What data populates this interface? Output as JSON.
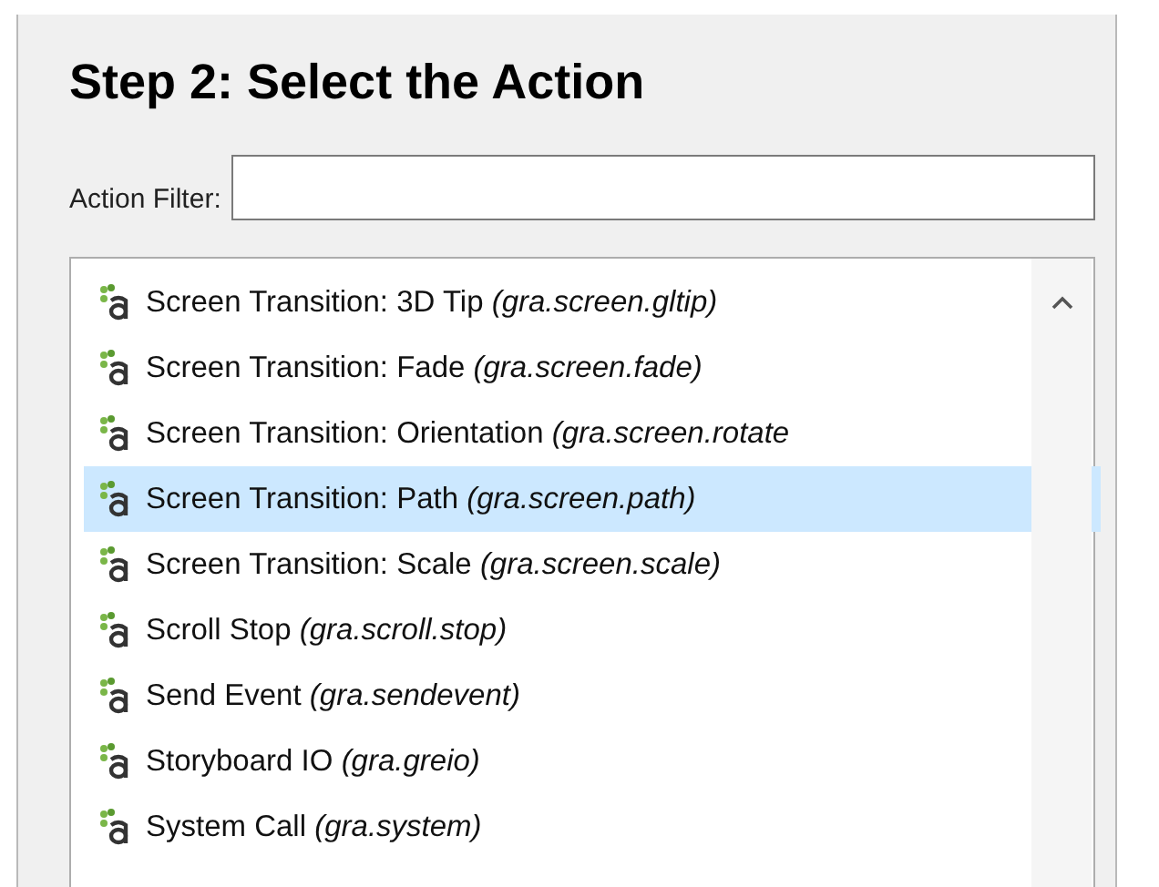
{
  "heading": "Step 2: Select the Action",
  "filter": {
    "label": "Action Filter:"
  },
  "actions": [
    {
      "text": "Screen Transition: 3D Tip *(gra.screen.gltip)*",
      "selected": false
    },
    {
      "text": "Screen Transition: Fade *(gra.screen.fade)*",
      "selected": false
    },
    {
      "text": "Screen Transition: Orientation *(gra.screen.rotate*",
      "selected": false
    },
    {
      "text": "Screen Transition: Path *(gra.screen.path)*",
      "selected": true
    },
    {
      "text": "Screen Transition: Scale *(gra.screen.scale)*",
      "selected": false
    },
    {
      "text": "Scroll Stop *(gra.scroll.stop)*",
      "selected": false
    },
    {
      "text": "Send Event *(gra.sendevent)*",
      "selected": false
    },
    {
      "text": "Storyboard IO *(gra.greio)*",
      "selected": false
    },
    {
      "text": "System Call *(gra.system)*",
      "selected": false
    }
  ]
}
